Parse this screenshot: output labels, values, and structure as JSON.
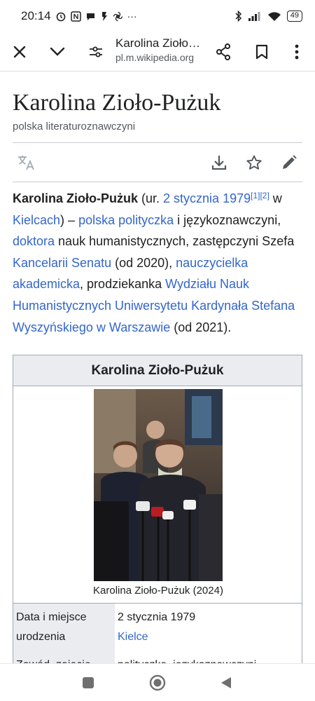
{
  "status_bar": {
    "time": "20:14",
    "battery": "49"
  },
  "toolbar": {
    "title": "Karolina Zioło…",
    "url": "pl.m.wikipedia.org"
  },
  "article": {
    "title": "Karolina Zioło-Pużuk",
    "description": "polska literaturoznawczyni",
    "intro": {
      "bold_name": "Karolina Zioło-Pużuk",
      "t1": " (ur. ",
      "l_date": "2 stycznia 1979",
      "ref1": "[1]",
      "ref2": "[2]",
      "t2": " w ",
      "l_city": "Kielcach",
      "t3": ") – ",
      "l_politician": "polska polityczka",
      "t4": " i językoznawczyni, ",
      "l_doctor": "doktora",
      "t5": " nauk humanistycznych, zastępczyni Szefa ",
      "l_chancellery": "Kancelarii Senatu",
      "t6": " (od 2020), ",
      "l_teacher": "nauczycielka akademicka",
      "t7": ", prodziekanka ",
      "l_faculty": "Wydziału Nauk Humanistycznych Uniwersytetu Kardynała Stefana Wyszyńskiego w Warszawie",
      "t8": " (od 2021)."
    }
  },
  "infobox": {
    "header": "Karolina Zioło-Pużuk",
    "caption": "Karolina Zioło-Pużuk (2024)",
    "rows": [
      {
        "label": "Data i miejsce urodzenia",
        "value": "2 stycznia 1979",
        "link": "Kielce"
      },
      {
        "label": "Zawód, zajęcie",
        "value": "polityczka, językoznawczyni"
      }
    ]
  },
  "icons": {
    "close": "close-icon",
    "collapse": "chevron-down-icon",
    "site_settings": "tune-icon",
    "share": "share-icon",
    "bookmark": "bookmark-icon",
    "menu": "more-vert-icon",
    "translate": "translate-icon",
    "download": "download-icon",
    "watch": "star-icon",
    "edit": "pencil-icon",
    "recents": "recents-square-icon",
    "home": "home-circle-icon",
    "back": "back-triangle-icon"
  },
  "colors": {
    "link": "#3366cc",
    "text": "#202122",
    "muted": "#54595d",
    "infobox_header": "#eaecf0",
    "infobox_border": "#a2a9b1"
  }
}
